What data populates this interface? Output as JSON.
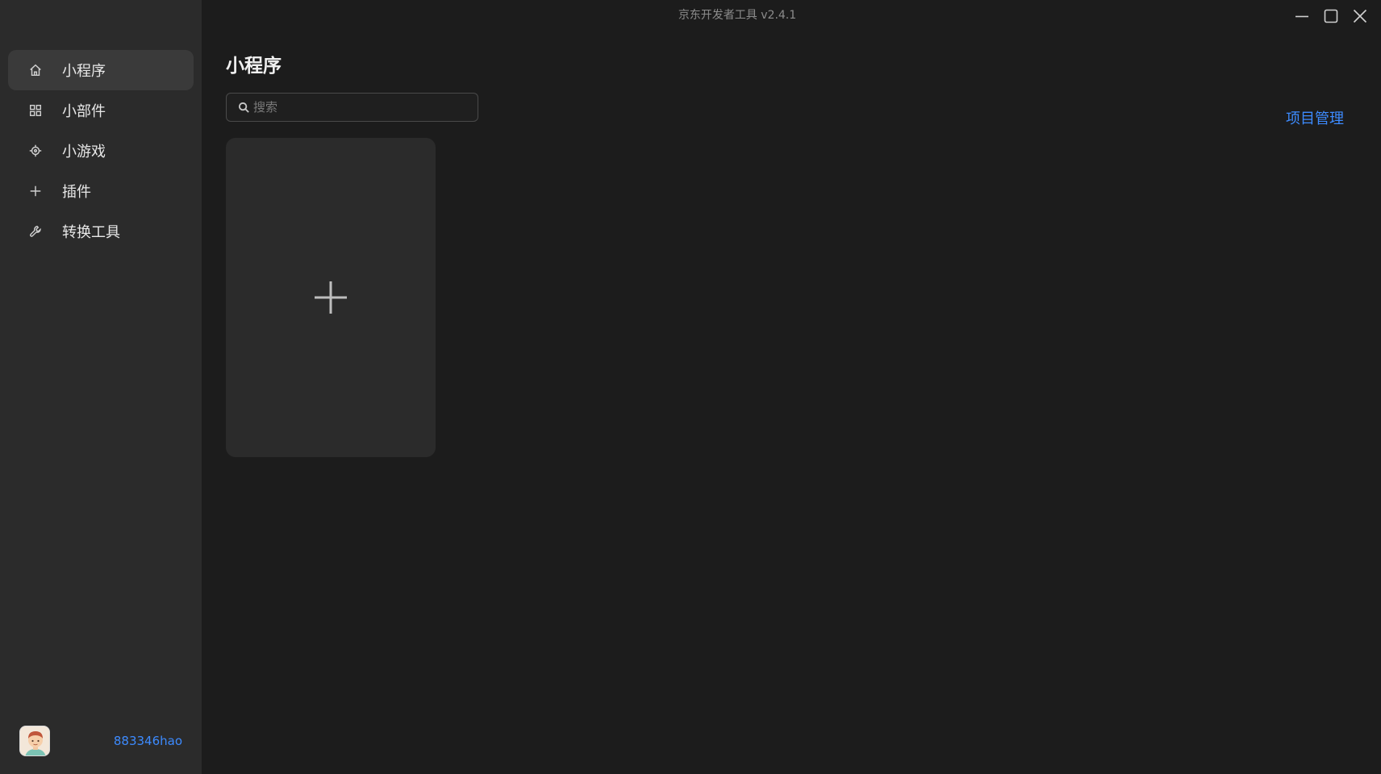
{
  "window": {
    "title": "京东开发者工具 v2.4.1"
  },
  "sidebar": {
    "items": [
      {
        "label": "小程序",
        "icon": "home-icon",
        "active": true
      },
      {
        "label": "小部件",
        "icon": "grid-icon",
        "active": false
      },
      {
        "label": "小游戏",
        "icon": "target-icon",
        "active": false
      },
      {
        "label": "插件",
        "icon": "plus-icon",
        "active": false
      },
      {
        "label": "转换工具",
        "icon": "wrench-icon",
        "active": false
      }
    ],
    "user": {
      "name": "883346hao"
    }
  },
  "main": {
    "title": "小程序",
    "search": {
      "placeholder": "搜索",
      "value": ""
    },
    "project_management_label": "项目管理",
    "add_card_icon": "plus-icon"
  },
  "colors": {
    "accent": "#3d8bff",
    "sidebar_bg": "#2b2b2b",
    "main_bg": "#1c1c1c",
    "card_bg": "#2b2b2b"
  }
}
